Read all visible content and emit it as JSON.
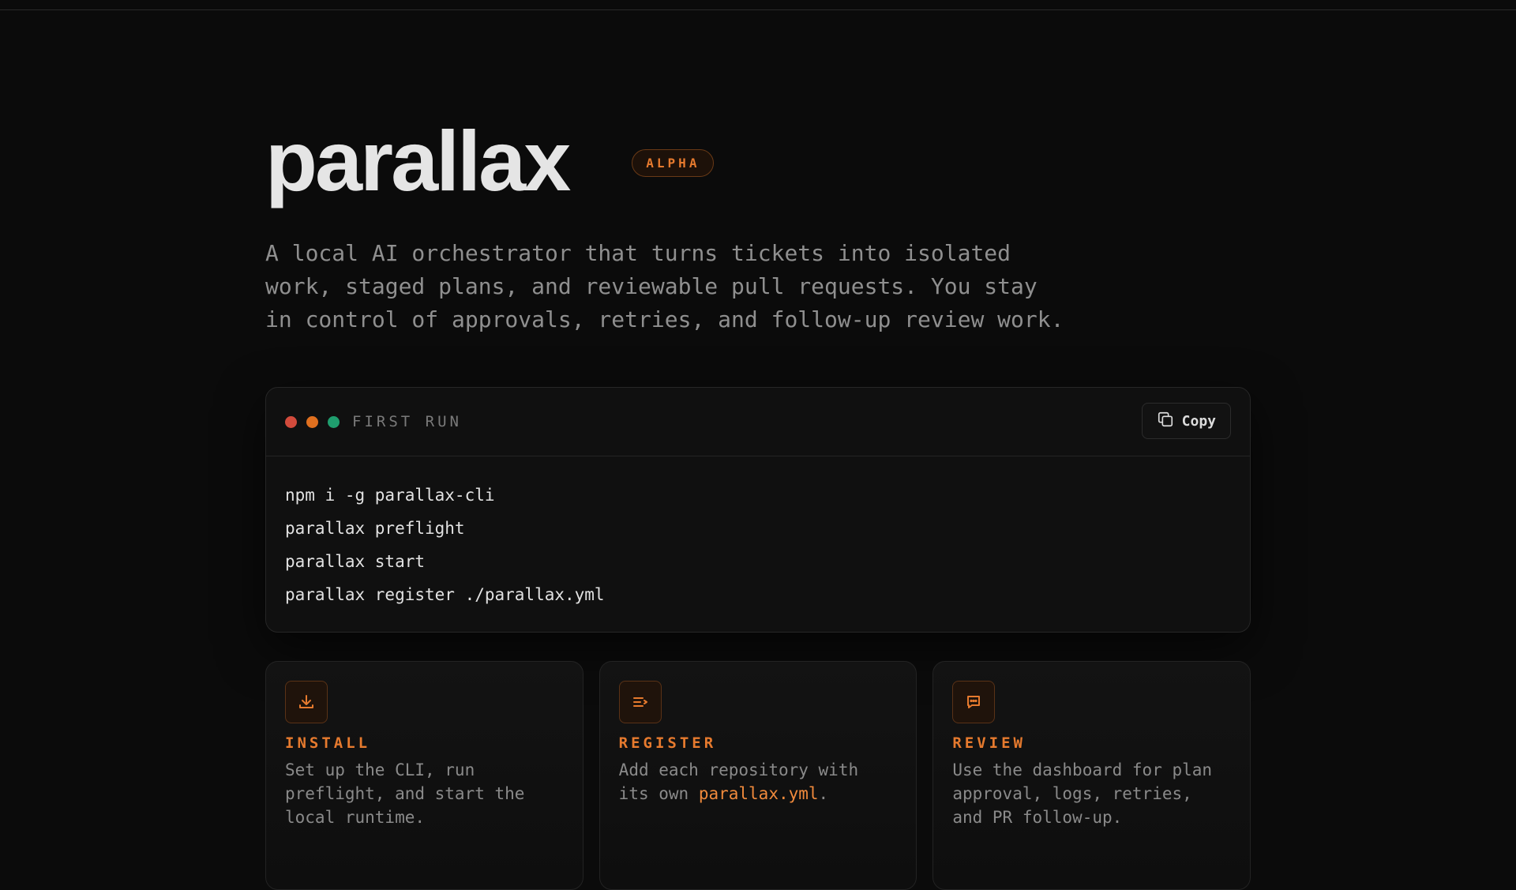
{
  "hero": {
    "title": "parallax",
    "badge": "ALPHA",
    "tagline": "A local AI orchestrator that turns tickets into isolated work, staged plans, and reviewable pull requests. You stay in control of approvals, retries, and follow-up review work."
  },
  "terminal": {
    "label": "FIRST RUN",
    "copy_label": "Copy",
    "dots": [
      "#d24b3c",
      "#e0701f",
      "#1f9e6e"
    ],
    "commands": [
      "npm i -g parallax-cli",
      "parallax preflight",
      "parallax start",
      "parallax register ./parallax.yml"
    ]
  },
  "cards": [
    {
      "icon": "download-icon",
      "title": "INSTALL",
      "text": "Set up the CLI, run preflight, and start the local runtime."
    },
    {
      "icon": "register-icon",
      "title": "REGISTER",
      "text_before": "Add each repository with its own ",
      "text_code": "parallax.yml",
      "text_after": "."
    },
    {
      "icon": "chat-icon",
      "title": "REVIEW",
      "text": "Use the dashboard for plan approval, logs, retries, and PR follow-up."
    }
  ],
  "colors": {
    "accent": "#e67a2e",
    "background": "#0b0b0b"
  }
}
